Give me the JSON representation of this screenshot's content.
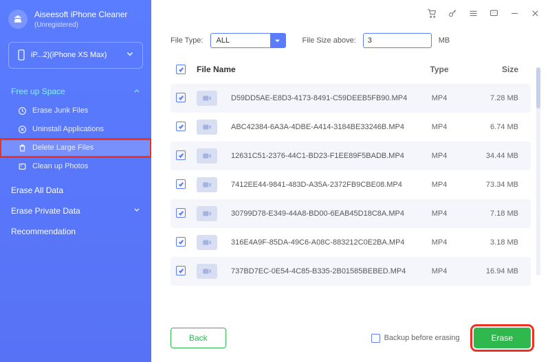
{
  "brand": {
    "title": "Aiseesoft iPhone Cleaner",
    "subtitle": "(Unregistered)"
  },
  "device": "iP...2)(iPhone XS Max)",
  "sidebar": {
    "free_up_space": "Free up Space",
    "items": [
      "Erase Junk Files",
      "Uninstall Applications",
      "Delete Large Files",
      "Clean up Photos"
    ],
    "erase_all": "Erase All Data",
    "erase_private": "Erase Private Data",
    "recommendation": "Recommendation"
  },
  "filters": {
    "type_label": "File Type:",
    "type_value": "ALL",
    "size_label": "File Size above:",
    "size_value": "3",
    "size_unit": "MB"
  },
  "table": {
    "headers": {
      "name": "File Name",
      "type": "Type",
      "size": "Size"
    },
    "files": [
      {
        "name": "D59DD5AE-E8D3-4173-8491-C59DEEB5FB90.MP4",
        "type": "MP4",
        "size": "7.28 MB"
      },
      {
        "name": "ABC42384-6A3A-4DBE-A414-3184BE33246B.MP4",
        "type": "MP4",
        "size": "6.74 MB"
      },
      {
        "name": "12631C51-2376-44C1-BD23-F1EE89F5BADB.MP4",
        "type": "MP4",
        "size": "34.44 MB"
      },
      {
        "name": "7412EE44-9841-483D-A35A-2372FB9CBE08.MP4",
        "type": "MP4",
        "size": "73.34 MB"
      },
      {
        "name": "30799D78-E349-44A8-BD00-6EAB45D18C8A.MP4",
        "type": "MP4",
        "size": "7.18 MB"
      },
      {
        "name": "316E4A9F-85DA-49C6-A08C-883212C0E2BA.MP4",
        "type": "MP4",
        "size": "3.18 MB"
      },
      {
        "name": "737BD7EC-0E54-4C85-B335-2B01585BEBED.MP4",
        "type": "MP4",
        "size": "16.94 MB"
      }
    ]
  },
  "footer": {
    "back": "Back",
    "backup": "Backup before erasing",
    "erase": "Erase"
  }
}
